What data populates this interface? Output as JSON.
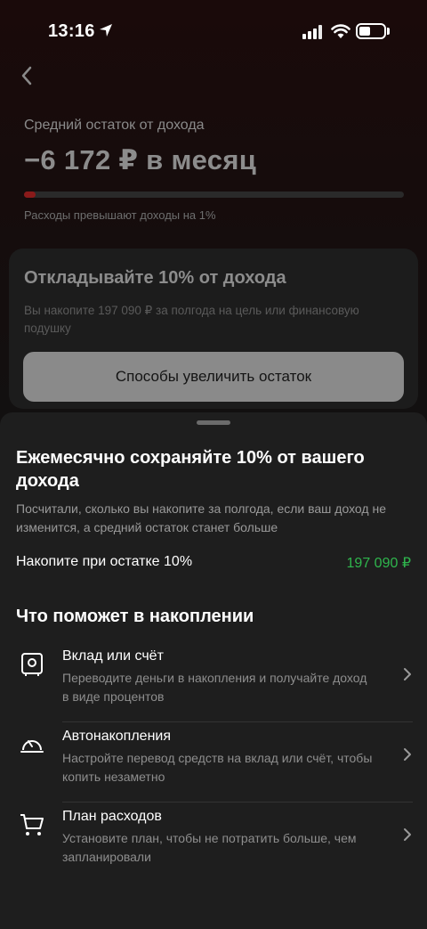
{
  "status_bar": {
    "time": "13:16"
  },
  "background": {
    "avg_label": "Средний остаток от дохода",
    "avg_value": "−6 172 ₽ в месяц",
    "progress_fraction": 0.03,
    "avg_note": "Расходы превышают доходы на 1%",
    "card": {
      "title": "Откладывайте 10% от дохода",
      "desc": "Вы накопите 197 090 ₽ за полгода на цель или финансовую подушку",
      "button_label": "Способы увеличить остаток"
    }
  },
  "sheet": {
    "title": "Ежемесячно сохраняйте 10% от вашего дохода",
    "desc": "Посчитали, сколько вы накопите за полгода, если ваш доход не изменится, а средний остаток станет больше",
    "accum_label": "Накопите при остатке 10%",
    "accum_value": "197 090 ₽",
    "section_title": "Что поможет в накоплении",
    "items": [
      {
        "icon": "safe-icon",
        "title": "Вклад или счёт",
        "desc": "Переводите деньги в накопления и получайте доход в виде процентов"
      },
      {
        "icon": "auto-saving-icon",
        "title": "Автонакопления",
        "desc": "Настройте перевод средств на вклад или счёт, чтобы копить незаметно"
      },
      {
        "icon": "cart-icon",
        "title": "План расходов",
        "desc": "Установите план, чтобы не потратить больше, чем запланировали"
      }
    ]
  },
  "colors": {
    "accent_green": "#2fb64d",
    "progress_red": "#8a1a1a"
  }
}
